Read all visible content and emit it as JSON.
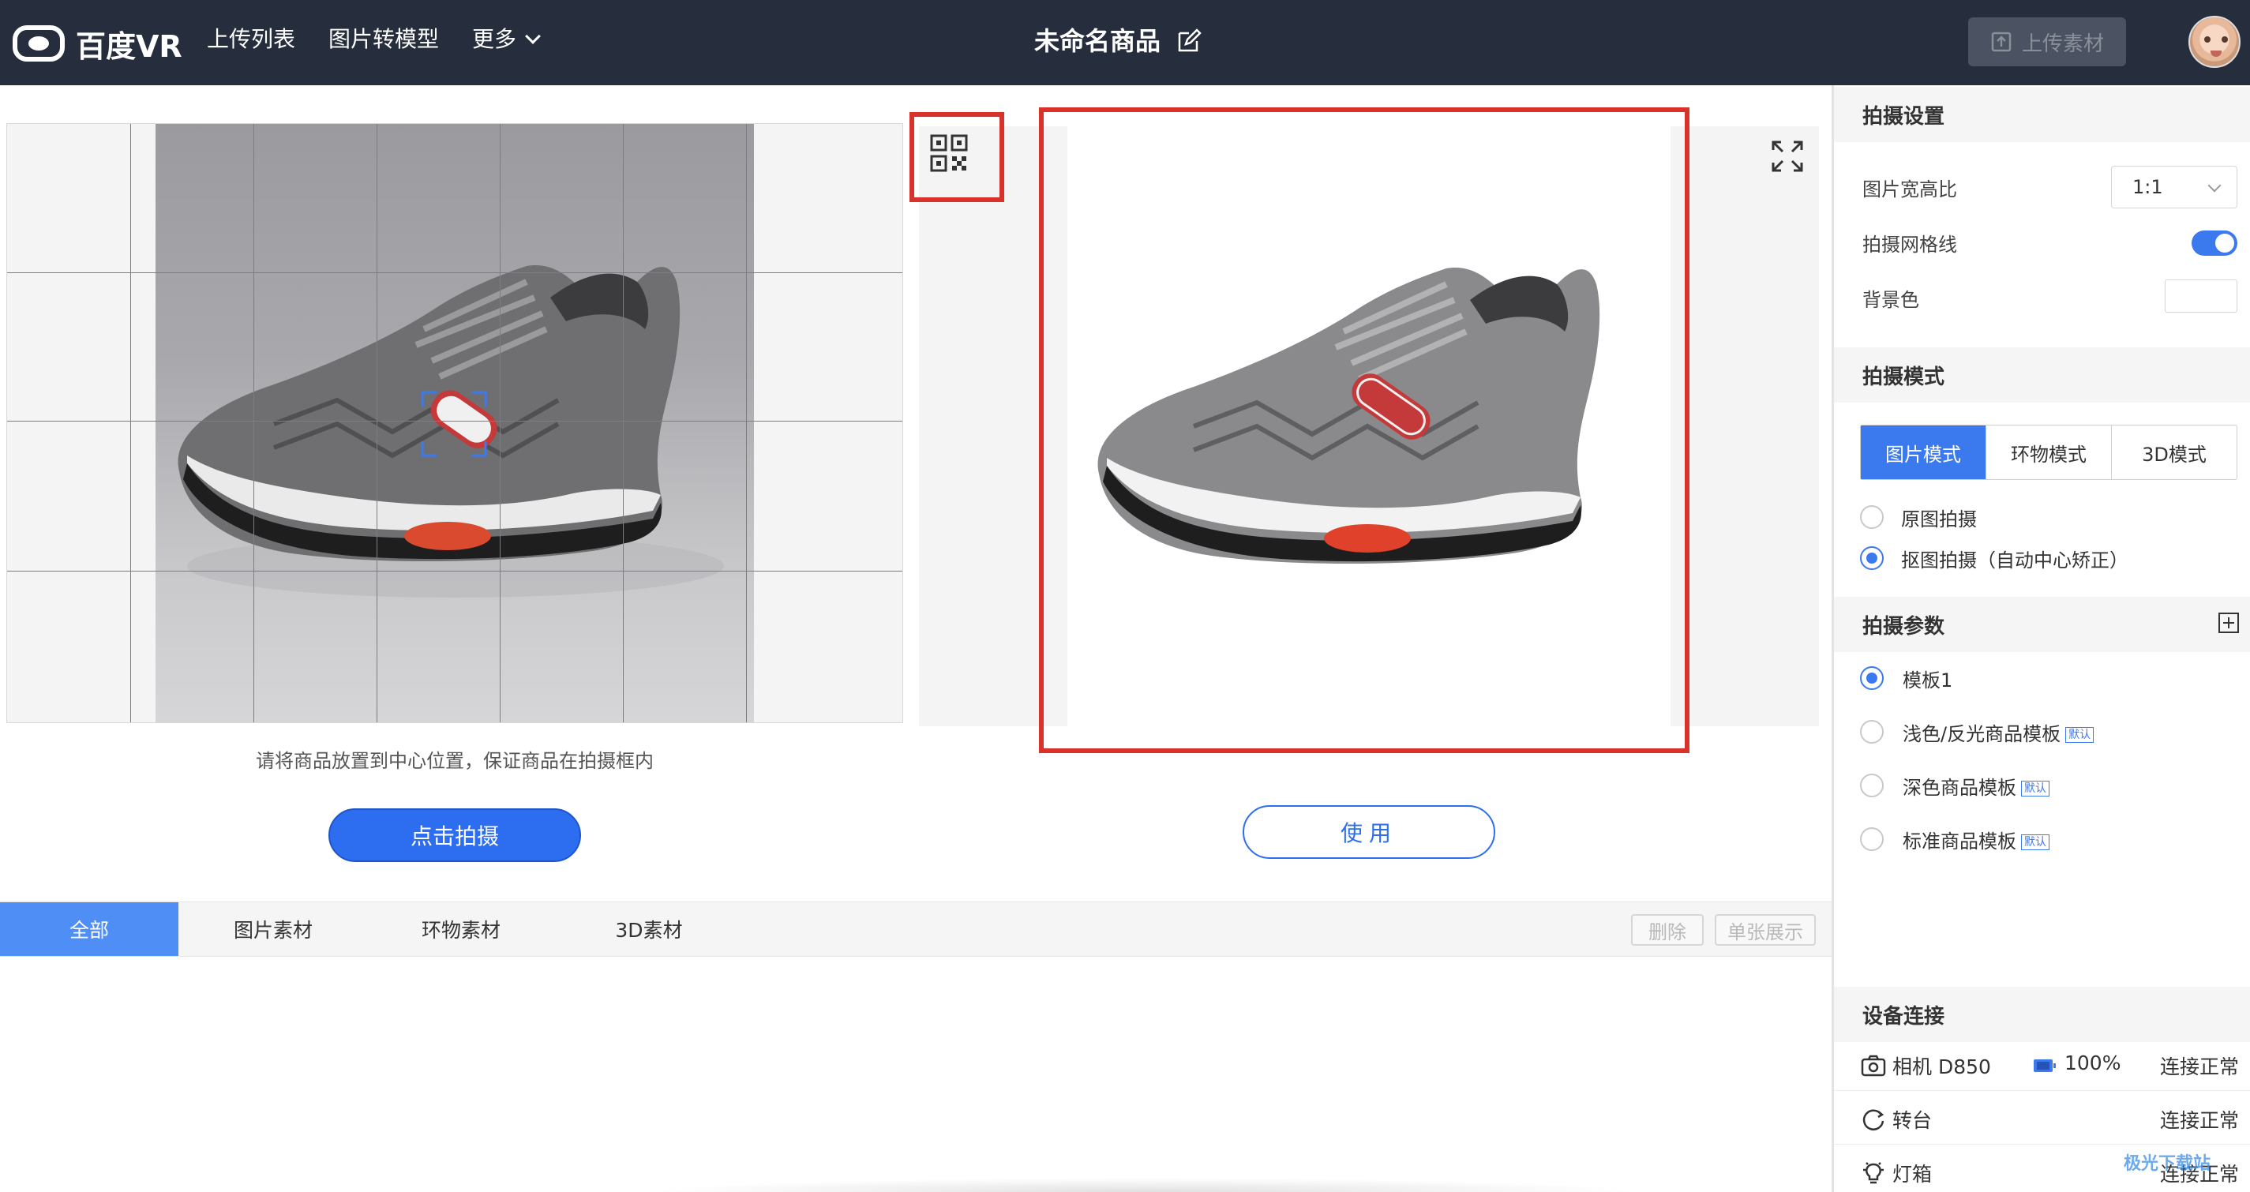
{
  "header": {
    "logo_text": "百度VR",
    "nav": [
      "上传列表",
      "图片转模型",
      "更多"
    ],
    "doc_title": "未命名商品",
    "upload_label": "上传素材"
  },
  "capture": {
    "hint": "请将商品放置到中心位置，保证商品在拍摄框内",
    "shoot_label": "点击拍摄"
  },
  "preview": {
    "use_label": "使用"
  },
  "tabs": {
    "items": [
      "全部",
      "图片素材",
      "环物素材",
      "3D素材"
    ],
    "active": "全部",
    "delete_label": "删除",
    "single_label": "单张展示"
  },
  "settings": {
    "shoot_settings_title": "拍摄设置",
    "ratio_label": "图片宽高比",
    "ratio_value": "1:1",
    "grid_label": "拍摄网格线",
    "grid_enabled": true,
    "bg_label": "背景色",
    "bg_color": "#ffffff",
    "shoot_mode_title": "拍摄模式",
    "modes": [
      "图片模式",
      "环物模式",
      "3D模式"
    ],
    "active_mode": "图片模式",
    "mode_options": [
      "原图拍摄",
      "抠图拍摄（自动中心矫正）"
    ],
    "selected_mode_option": "抠图拍摄（自动中心矫正）",
    "params_title": "拍摄参数",
    "templates": [
      "模板1",
      "浅色/反光商品模板",
      "深色商品模板",
      "标准商品模板"
    ],
    "selected_template": "模板1",
    "default_tag": "默认",
    "device_title": "设备连接",
    "devices": [
      {
        "name": "相机 D850",
        "battery": "100%",
        "status": "连接正常"
      },
      {
        "name": "转台",
        "status": "连接正常"
      },
      {
        "name": "灯箱",
        "status": "连接正常"
      }
    ]
  },
  "watermark": "极光下载站",
  "colors": {
    "header_bg": "#262d3d",
    "accent": "#3b79ef",
    "highlight_red": "#d9322b"
  }
}
